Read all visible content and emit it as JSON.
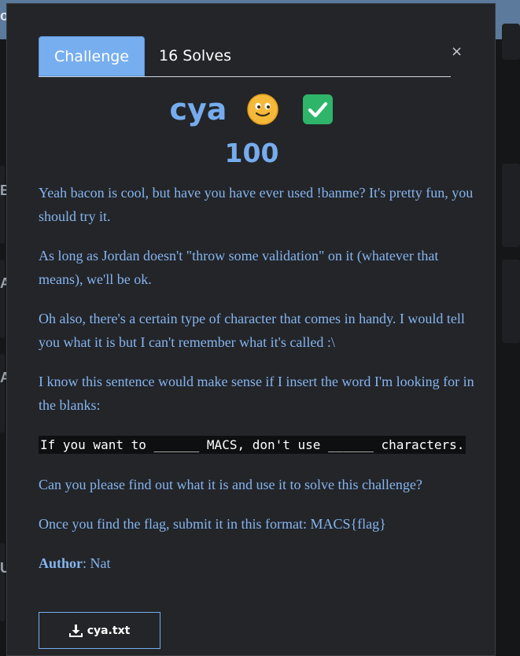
{
  "background": {
    "fragments": [
      "o",
      "Bi",
      "Ac",
      "Ac",
      "U"
    ]
  },
  "tabs": {
    "challenge": "Challenge",
    "solves": "16 Solves"
  },
  "close_icon": "×",
  "challenge": {
    "name": "cya",
    "points": "100",
    "solved_icon": "check-mark-icon",
    "face_icon": "smiling-face-icon"
  },
  "description": {
    "p1": "Yeah bacon is cool, but have you have ever used !banme? It's pretty fun, you should try it.",
    "p2": "As long as Jordan doesn't \"throw some validation\" on it (whatever that means), we'll be ok.",
    "p3": "Oh also, there's a certain type of character that comes in handy. I would tell you what it is but I can't remember what it's called :\\",
    "p4": "I know this sentence would make sense if I insert the word I'm looking for in the blanks:",
    "code": "If you want to ______ MACS, don't use ______ characters.",
    "p5": "Can you please find out what it is and use it to solve this challenge?",
    "p6": "Once you find the flag, submit it in this format: MACS{flag}",
    "author_label": "Author",
    "author_sep": ":",
    "author_name": " Nat"
  },
  "download": {
    "label": "cya.txt",
    "icon": "download-icon"
  },
  "colors": {
    "accent": "#77aef0",
    "text": "#86b5ef",
    "modal_bg": "#232529",
    "check_green": "#2fb56a"
  }
}
